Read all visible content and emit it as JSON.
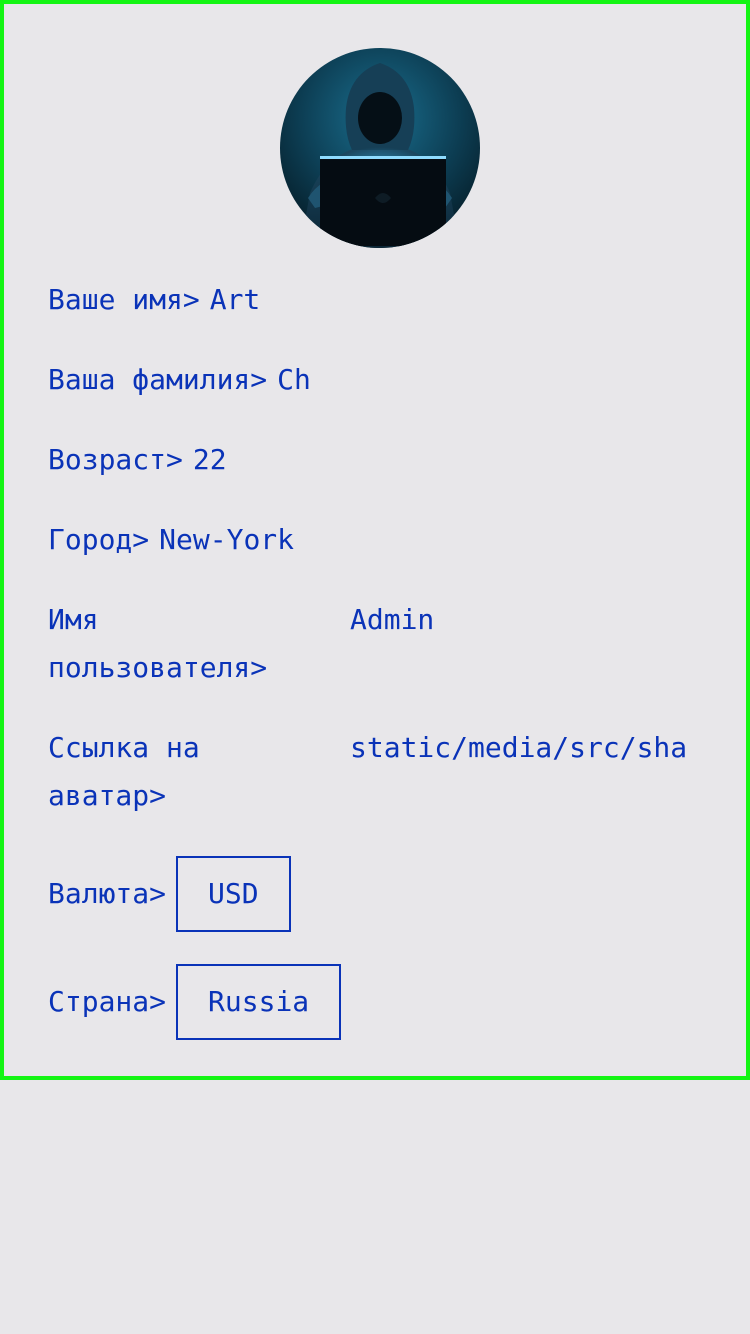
{
  "profile": {
    "avatar": {
      "icon": "hacker-avatar-icon",
      "colors": {
        "bg": "#0d3f55",
        "hood": "#123447",
        "laptop": "#050c12"
      }
    },
    "first_name": {
      "label": "Ваше имя>",
      "value": "Art"
    },
    "last_name": {
      "label": "Ваша фамилия>",
      "value": "Ch"
    },
    "age": {
      "label": "Возраст>",
      "value": "22"
    },
    "city": {
      "label": "Город>",
      "value": "New-York"
    },
    "username": {
      "label": "Имя пользователя>",
      "value": "Admin"
    },
    "avatar_link": {
      "label": "Ссылка на аватар>",
      "value": "static/media/src/sha"
    },
    "currency": {
      "label": "Валюта>",
      "value": "USD"
    },
    "country": {
      "label": "Страна>",
      "value": "Russia"
    }
  },
  "theme": {
    "text_color": "#0a33b8",
    "page_background": "#e8e7ea",
    "card_border": "#14f514"
  }
}
